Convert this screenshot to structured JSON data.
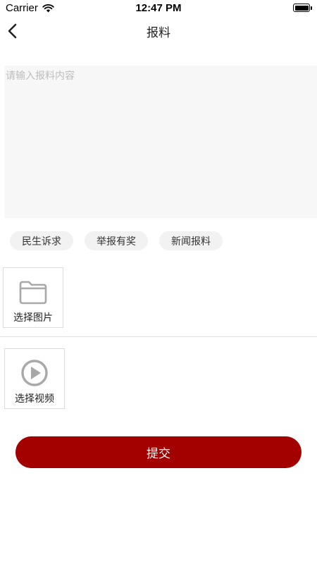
{
  "status_bar": {
    "carrier": "Carrier",
    "time": "12:47 PM",
    "wifi_icon": "wifi-icon",
    "battery_icon": "battery-icon"
  },
  "nav": {
    "back_icon": "chevron-left-icon",
    "title": "报料"
  },
  "form": {
    "content_placeholder": "请输入报料内容",
    "content_value": ""
  },
  "tags": [
    {
      "label": "民生诉求"
    },
    {
      "label": "举报有奖"
    },
    {
      "label": "新闻报料"
    }
  ],
  "pickers": {
    "image": {
      "label": "选择图片",
      "icon": "folder-icon"
    },
    "video": {
      "label": "选择视频",
      "icon": "play-circle-icon"
    }
  },
  "submit": {
    "label": "提交"
  },
  "colors": {
    "accent": "#a30000",
    "input_background": "#f7f7f7",
    "tag_background": "#f2f2f2",
    "icon_gray": "#a8a8a8"
  }
}
